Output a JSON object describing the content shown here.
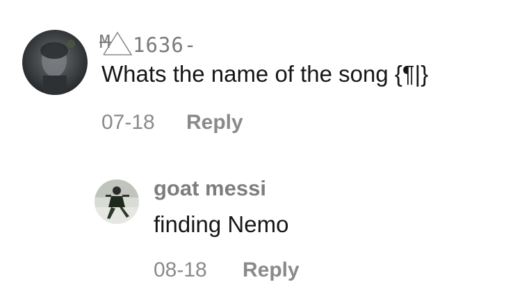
{
  "comments": [
    {
      "username_prefix": "M",
      "username": "1636-",
      "text": "Whats the name of the song {¶|}",
      "date": "07-18",
      "reply_label": "Reply"
    },
    {
      "username": "goat messi",
      "text": "finding Nemo",
      "date": "08-18",
      "reply_label": "Reply"
    }
  ],
  "colors": {
    "text": "#161616",
    "muted": "#8a8a8a"
  }
}
